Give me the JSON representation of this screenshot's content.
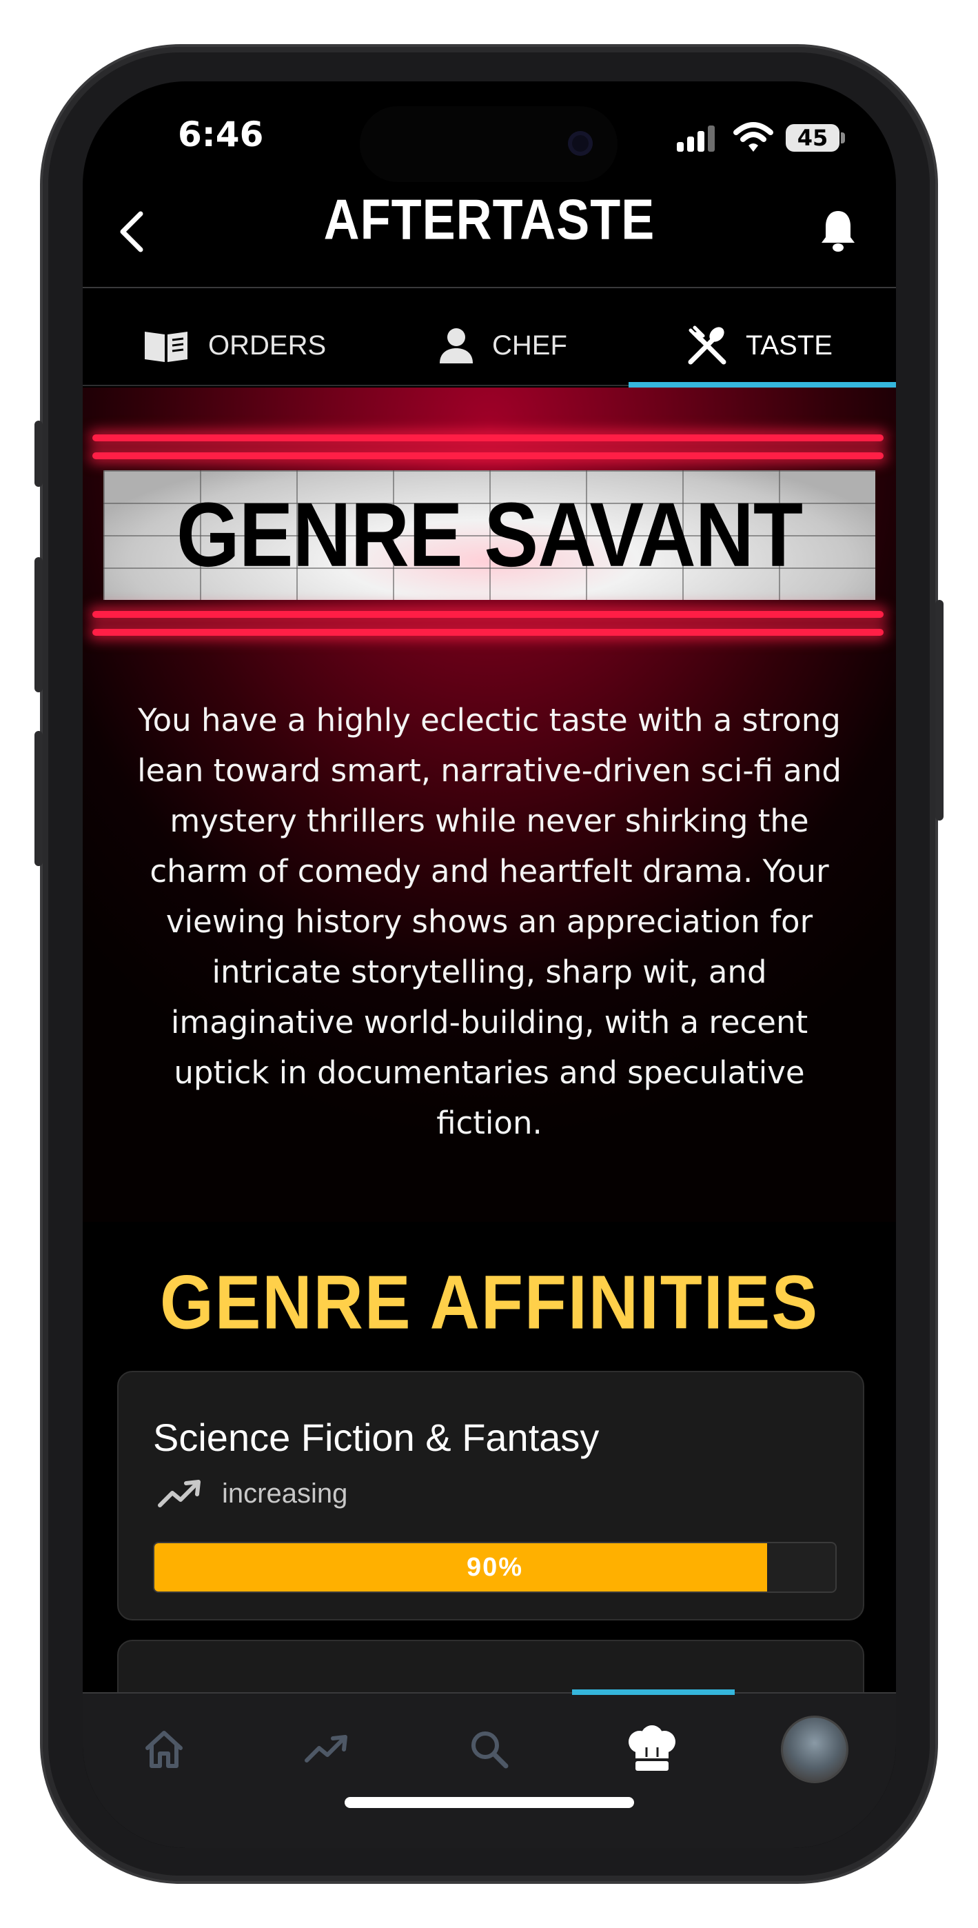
{
  "status_bar": {
    "time": "6:46",
    "battery": "45",
    "icons": [
      "signal-icon",
      "wifi-icon",
      "battery-icon"
    ]
  },
  "header": {
    "title": "AFTERTASTE",
    "back_icon": "chevron-left-icon",
    "notification_icon": "bell-icon"
  },
  "tabs": [
    {
      "label": "ORDERS",
      "icon": "book-icon",
      "active": false
    },
    {
      "label": "CHEF",
      "icon": "person-icon",
      "active": false
    },
    {
      "label": "TASTE",
      "icon": "utensils-icon",
      "active": true
    }
  ],
  "hero": {
    "marquee_title": "GENRE SAVANT",
    "description": "You have a highly eclectic taste with a strong lean toward smart, narrative-driven sci-fi and mystery thrillers while never shirking the charm of comedy and heartfelt drama. Your viewing history shows an appreciation for intricate storytelling, sharp wit, and imaginative world-building, with a recent uptick in documentaries and speculative fiction."
  },
  "affinities": {
    "title": "GENRE AFFINITIES",
    "items": [
      {
        "name": "Science Fiction & Fantasy",
        "trend": "increasing",
        "trend_icon": "trending-up-icon",
        "percent_label": "90%",
        "percent": 90
      }
    ]
  },
  "bottom_nav": {
    "items": [
      {
        "icon": "home-icon",
        "active": false
      },
      {
        "icon": "trending-up-icon",
        "active": false
      },
      {
        "icon": "search-icon",
        "active": false
      },
      {
        "icon": "chef-hat-icon",
        "active": true
      },
      {
        "icon": "avatar",
        "active": false
      }
    ]
  },
  "colors": {
    "accent": "#35b6dc",
    "section_title": "#ffd04a",
    "progress_fill": "#ffb000",
    "neon": "#ff1f46"
  }
}
